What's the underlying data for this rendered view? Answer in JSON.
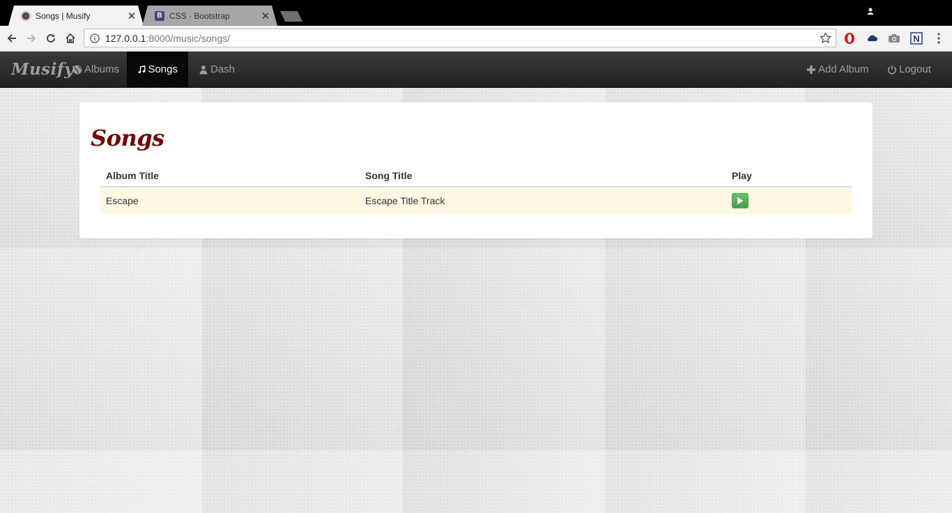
{
  "browser": {
    "tabs": [
      {
        "title": "Songs | Musify",
        "close": "✕",
        "active": true
      },
      {
        "title": "CSS · Bootstrap",
        "favicon_text": "B",
        "close": "✕",
        "active": false
      }
    ],
    "url": {
      "host": "127.0.0.1",
      "path": ":8000/music/songs/"
    }
  },
  "navbar": {
    "brand": "Musify",
    "items": [
      {
        "label": "Albums",
        "icon": "globe-icon"
      },
      {
        "label": "Songs",
        "icon": "music-note-icon",
        "active": true
      },
      {
        "label": "Dash",
        "icon": "user-icon"
      }
    ],
    "right": [
      {
        "label": "Add Album",
        "icon": "plus-icon"
      },
      {
        "label": "Logout",
        "icon": "power-icon"
      }
    ]
  },
  "page": {
    "heading": "Songs",
    "table": {
      "headers": [
        "Album Title",
        "Song Title",
        "Play"
      ],
      "rows": [
        {
          "album": "Escape",
          "song": "Escape Title Track",
          "play_icon": "play-icon"
        }
      ]
    }
  },
  "colors": {
    "heading": "#7b0000",
    "row_highlight": "#fcf8e3",
    "play_button": "#5cb85c",
    "navbar": "#222222"
  }
}
